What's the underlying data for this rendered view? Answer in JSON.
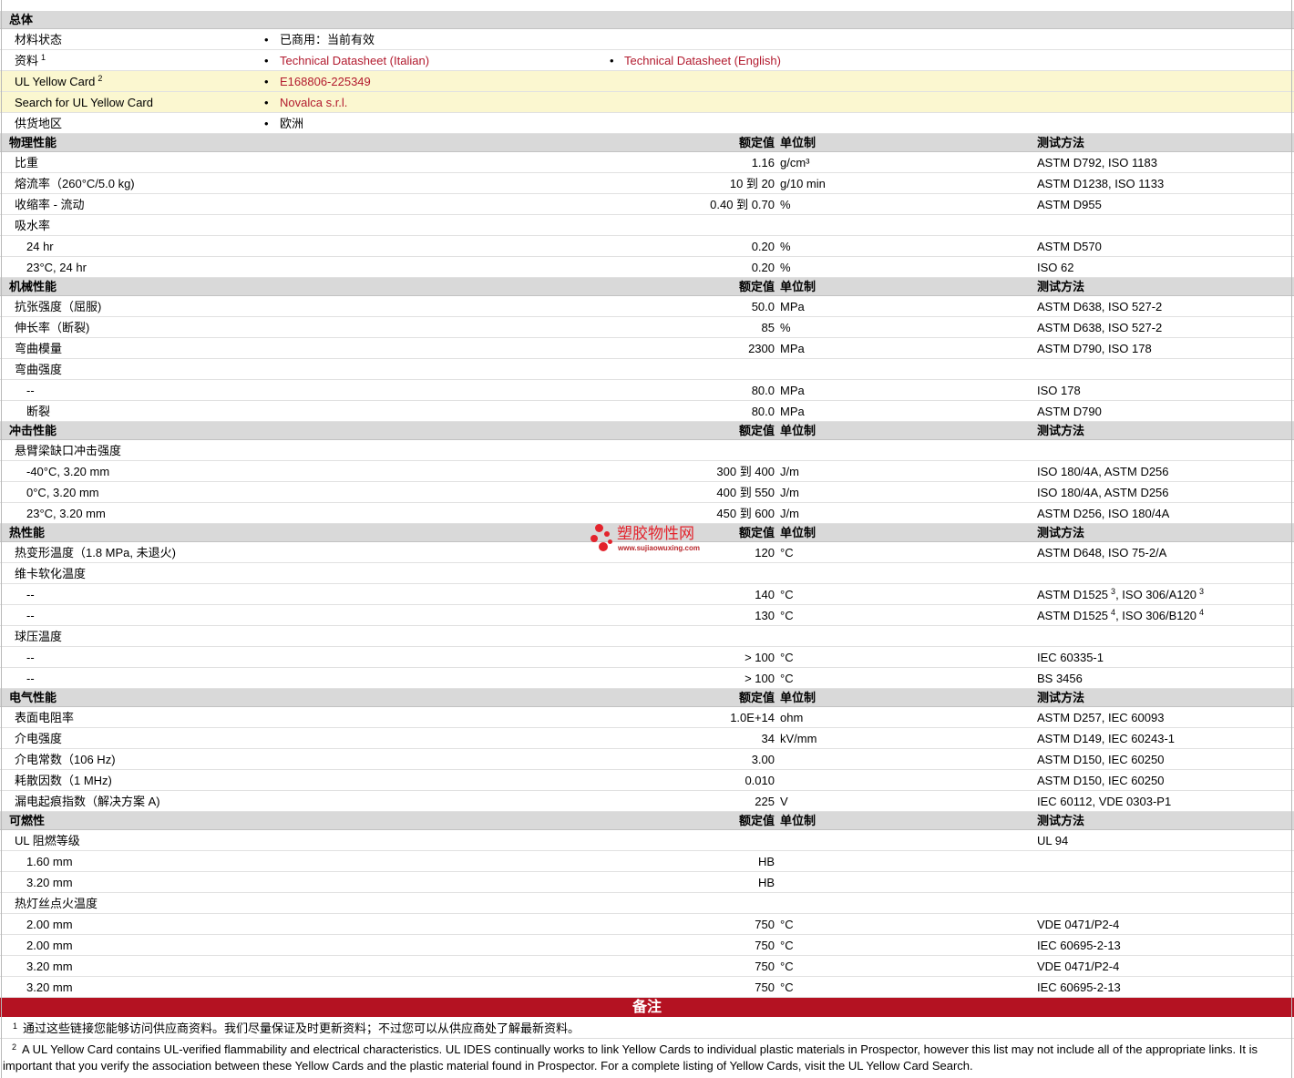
{
  "general": {
    "title": "总体",
    "rows": [
      {
        "label": "材料状态",
        "items": [
          {
            "text": "已商用：当前有效"
          }
        ]
      },
      {
        "label": "资料",
        "sup": "1",
        "items": [
          {
            "text": "Technical Datasheet (Italian)",
            "link": true
          },
          {
            "text": "Technical Datasheet (English)",
            "link": true
          }
        ]
      },
      {
        "label": "UL Yellow Card",
        "sup": "2",
        "highlight": true,
        "items": [
          {
            "text": "E168806-225349",
            "link": true
          }
        ]
      },
      {
        "label": "Search for UL Yellow Card",
        "highlight": true,
        "items": [
          {
            "text": "Novalca s.r.l.",
            "link": true
          }
        ]
      },
      {
        "label": "供货地区",
        "items": [
          {
            "text": "欧洲"
          }
        ]
      }
    ]
  },
  "columns": {
    "value": "额定值",
    "unit": "单位制",
    "method": "测试方法"
  },
  "sections": [
    {
      "title": "物理性能",
      "rows": [
        {
          "label": "比重",
          "value": "1.16",
          "unit": "g/cm³",
          "method": "ASTM D792, ISO 1183"
        },
        {
          "label": "熔流率（260°C/5.0 kg)",
          "value": "10 到 20",
          "unit": "g/10 min",
          "method": "ASTM D1238, ISO 1133"
        },
        {
          "label": "收缩率 - 流动",
          "value": "0.40 到 0.70",
          "unit": "%",
          "method": "ASTM D955"
        },
        {
          "label": "吸水率"
        },
        {
          "label": "24 hr",
          "indent": true,
          "value": "0.20",
          "unit": "%",
          "method": "ASTM D570"
        },
        {
          "label": "23°C, 24 hr",
          "indent": true,
          "value": "0.20",
          "unit": "%",
          "method": "ISO 62"
        }
      ]
    },
    {
      "title": "机械性能",
      "rows": [
        {
          "label": "抗张强度（屈服)",
          "value": "50.0",
          "unit": "MPa",
          "method": "ASTM D638, ISO 527-2"
        },
        {
          "label": "伸长率（断裂)",
          "value": "85",
          "unit": "%",
          "method": "ASTM D638, ISO 527-2"
        },
        {
          "label": "弯曲模量",
          "value": "2300",
          "unit": "MPa",
          "method": "ASTM D790, ISO 178"
        },
        {
          "label": "弯曲强度"
        },
        {
          "label": "--",
          "indent": true,
          "value": "80.0",
          "unit": "MPa",
          "method": "ISO 178"
        },
        {
          "label": "断裂",
          "indent": true,
          "value": "80.0",
          "unit": "MPa",
          "method": "ASTM D790"
        }
      ]
    },
    {
      "title": "冲击性能",
      "rows": [
        {
          "label": "悬臂梁缺口冲击强度"
        },
        {
          "label": "-40°C, 3.20 mm",
          "indent": true,
          "value": "300 到 400",
          "unit": "J/m",
          "method": "ISO 180/4A, ASTM D256"
        },
        {
          "label": "0°C, 3.20 mm",
          "indent": true,
          "value": "400 到 550",
          "unit": "J/m",
          "method": "ISO 180/4A, ASTM D256"
        },
        {
          "label": "23°C, 3.20 mm",
          "indent": true,
          "value": "450 到 600",
          "unit": "J/m",
          "method": "ASTM D256, ISO 180/4A"
        }
      ]
    },
    {
      "title": "热性能",
      "rows": [
        {
          "label": "热变形温度（1.8 MPa, 未退火)",
          "value": "120",
          "unit": "°C",
          "method": "ASTM D648, ISO 75-2/A"
        },
        {
          "label": "维卡软化温度"
        },
        {
          "label": "--",
          "indent": true,
          "value": "140",
          "unit": "°C",
          "method_parts": [
            {
              "text": "ASTM D1525",
              "sup": "3"
            },
            {
              "text": ", ISO 306/A120",
              "sup": "3"
            }
          ]
        },
        {
          "label": "--",
          "indent": true,
          "value": "130",
          "unit": "°C",
          "method_parts": [
            {
              "text": "ASTM D1525",
              "sup": "4"
            },
            {
              "text": ", ISO 306/B120",
              "sup": "4"
            }
          ]
        },
        {
          "label": "球压温度"
        },
        {
          "label": "--",
          "indent": true,
          "value": "> 100",
          "unit": "°C",
          "method": "IEC 60335-1"
        },
        {
          "label": "--",
          "indent": true,
          "value": "> 100",
          "unit": "°C",
          "method": "BS 3456"
        }
      ]
    },
    {
      "title": "电气性能",
      "rows": [
        {
          "label": "表面电阻率",
          "value": "1.0E+14",
          "unit": "ohm",
          "method": "ASTM D257, IEC 60093"
        },
        {
          "label": "介电强度",
          "value": "34",
          "unit": "kV/mm",
          "method": "ASTM D149, IEC 60243-1"
        },
        {
          "label": "介电常数（106 Hz)",
          "value": "3.00",
          "method": "ASTM D150, IEC 60250"
        },
        {
          "label": "耗散因数（1 MHz)",
          "value": "0.010",
          "method": "ASTM D150, IEC 60250"
        },
        {
          "label": "漏电起痕指数（解决方案 A)",
          "value": "225",
          "unit": "V",
          "method": "IEC 60112, VDE 0303-P1"
        }
      ]
    },
    {
      "title": "可燃性",
      "rows": [
        {
          "label": "UL 阻燃等级",
          "method": "UL 94"
        },
        {
          "label": "1.60 mm",
          "indent": true,
          "value": "HB"
        },
        {
          "label": "3.20 mm",
          "indent": true,
          "value": "HB"
        },
        {
          "label": "热灯丝点火温度"
        },
        {
          "label": "2.00 mm",
          "indent": true,
          "value": "750",
          "unit": "°C",
          "method": "VDE 0471/P2-4"
        },
        {
          "label": "2.00 mm",
          "indent": true,
          "value": "750",
          "unit": "°C",
          "method": "IEC 60695-2-13"
        },
        {
          "label": "3.20 mm",
          "indent": true,
          "value": "750",
          "unit": "°C",
          "method": "VDE 0471/P2-4"
        },
        {
          "label": "3.20 mm",
          "indent": true,
          "value": "750",
          "unit": "°C",
          "method": "IEC 60695-2-13"
        }
      ]
    }
  ],
  "notes_title": "备注",
  "notes": [
    {
      "mark": "1",
      "text": "通过这些链接您能够访问供应商资料。我们尽量保证及时更新资料；不过您可以从供应商处了解最新资料。"
    },
    {
      "mark": "2",
      "text": "A UL Yellow Card contains UL-verified flammability and electrical characteristics. UL IDES continually works to link Yellow Cards to individual plastic materials in Prospector, however this list may not include all of the appropriate links. It is important that you verify the association between these Yellow Cards and the plastic material found in Prospector. For a complete listing of Yellow Cards, visit the UL Yellow Card Search."
    }
  ],
  "watermark": {
    "name": "塑胶物性网",
    "url": "www.sujiaowuxing.com"
  },
  "colors": {
    "link": "#b21a2e",
    "highlight": "#fbf7d0",
    "banner": "#b41222",
    "section_header": "#d9d9d9",
    "watermark": "#e3232c"
  }
}
